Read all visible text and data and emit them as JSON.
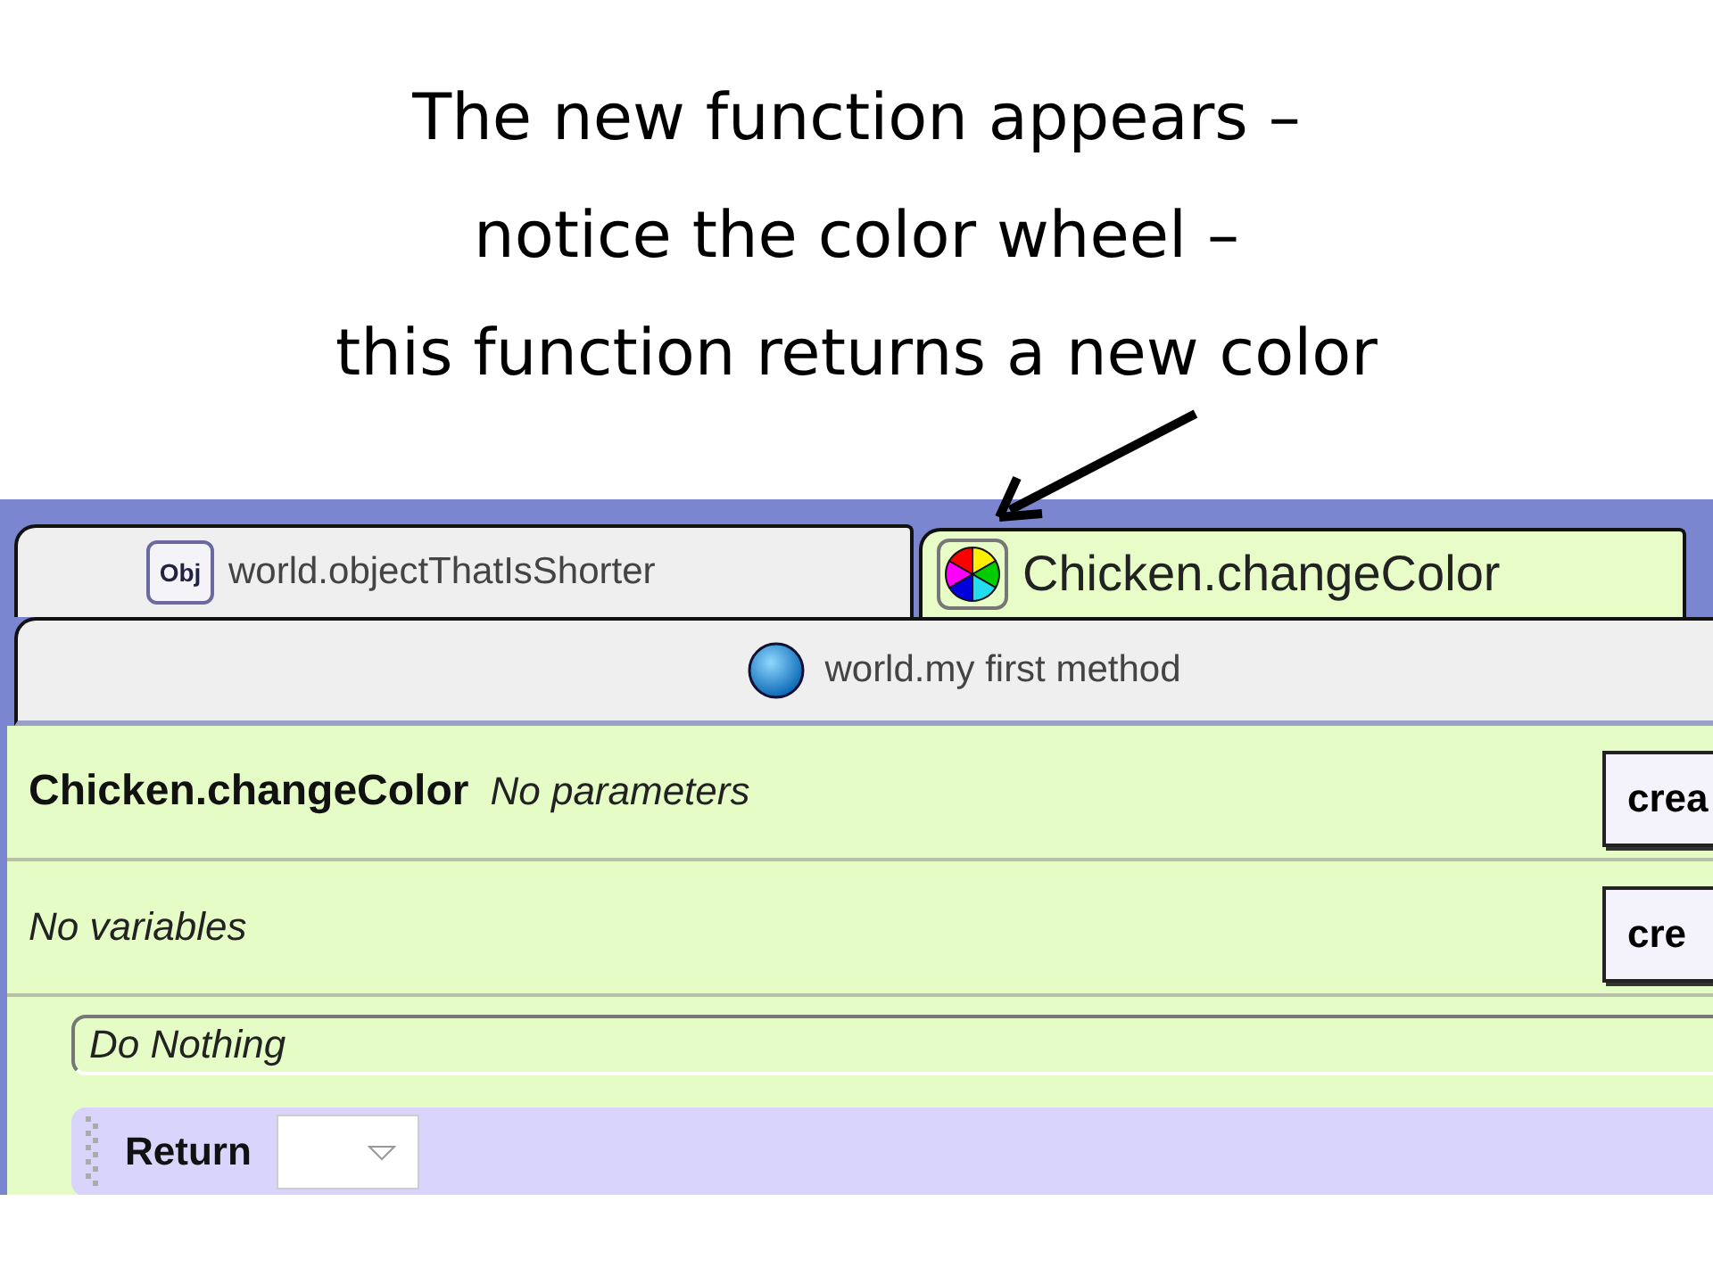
{
  "slide_title": [
    "The new function appears –",
    "notice the color wheel –",
    "this function returns a new color"
  ],
  "tabs": [
    {
      "label": "world.objectThatIsShorter",
      "kind": "object",
      "badge": "Obj",
      "selected": false
    },
    {
      "label": "Chicken.changeColor",
      "kind": "color",
      "selected": true
    }
  ],
  "subtabs": [
    {
      "label": "world.my first method",
      "kind": "method"
    }
  ],
  "method": {
    "name": "Chicken.changeColor",
    "parameters": "No parameters",
    "parameter_button": "crea",
    "variables": "No variables",
    "variable_button": "cre"
  },
  "statements": [
    {
      "kind": "empty",
      "label": "Do Nothing"
    },
    {
      "kind": "return",
      "label": "Return"
    }
  ]
}
